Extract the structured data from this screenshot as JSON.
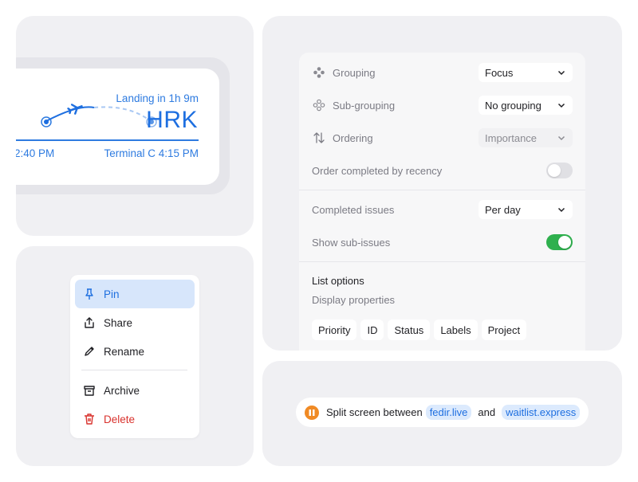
{
  "flight": {
    "landing": "Landing in 1h 9m",
    "destination": "HRK",
    "departure_time": "2:40 PM",
    "arrival": "Terminal C 4:15 PM",
    "accent": "#2e7be0"
  },
  "menu": {
    "items": [
      {
        "label": "Pin",
        "icon": "pin-icon",
        "active": true
      },
      {
        "label": "Share",
        "icon": "share-icon"
      },
      {
        "label": "Rename",
        "icon": "pencil-icon"
      },
      {
        "label": "Archive",
        "icon": "archive-icon"
      },
      {
        "label": "Delete",
        "icon": "trash-icon",
        "color": "#d9322d"
      }
    ]
  },
  "view_options": {
    "grouping": {
      "label": "Grouping",
      "value": "Focus"
    },
    "subgrouping": {
      "label": "Sub-grouping",
      "value": "No grouping"
    },
    "ordering": {
      "label": "Ordering",
      "value": "Importance"
    },
    "order_completed": {
      "label": "Order completed by recency",
      "enabled": false
    },
    "completed_issues": {
      "label": "Completed issues",
      "value": "Per day"
    },
    "show_subissues": {
      "label": "Show sub-issues",
      "enabled": true
    },
    "list_options": "List options",
    "display_properties": "Display properties",
    "properties": [
      "Priority",
      "ID",
      "Status",
      "Labels",
      "Project"
    ]
  },
  "split": {
    "text": "Split screen between",
    "site_a": "fedir.live",
    "conjunction": "and",
    "site_b": "waitlist.express",
    "accent": "#f08a24"
  }
}
